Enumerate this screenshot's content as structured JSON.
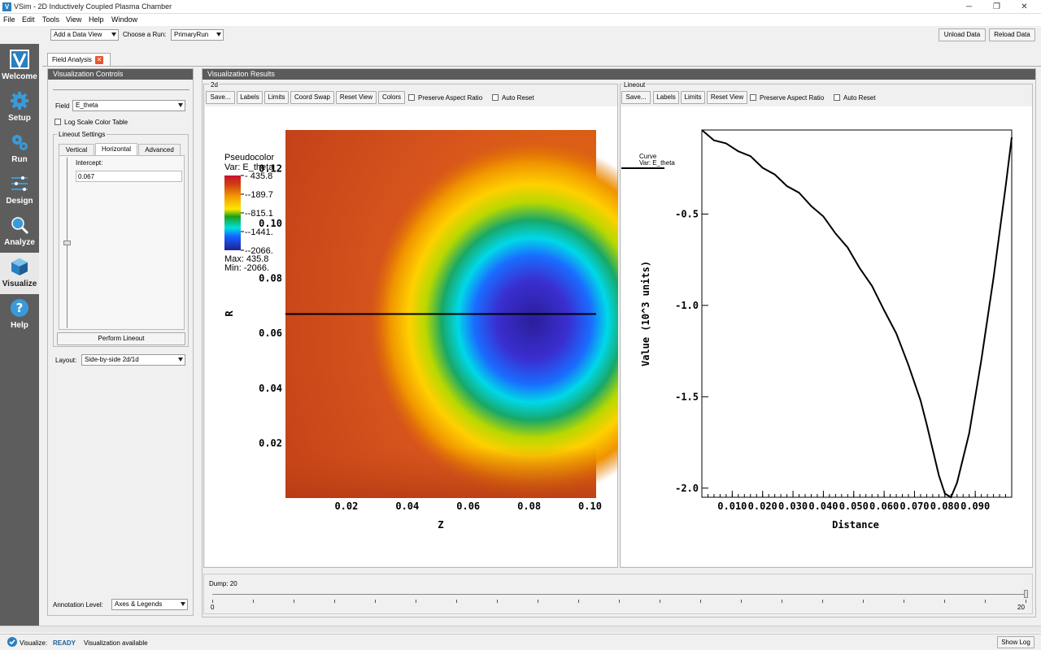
{
  "window": {
    "title": "VSim - 2D Inductively Coupled Plasma Chamber",
    "controls": [
      "─",
      "❐",
      "✕"
    ]
  },
  "menu": [
    "File",
    "Edit",
    "Tools",
    "View",
    "Help",
    "Window"
  ],
  "toolbar": {
    "add_view": "Add a Data View",
    "choose_run_label": "Choose a Run:",
    "run_value": "PrimaryRun",
    "unload": "Unload Data",
    "reload": "Reload Data"
  },
  "sidebar": [
    "Welcome",
    "Setup",
    "Run",
    "Design",
    "Analyze",
    "Visualize",
    "Help"
  ],
  "doc_tab": "Field Analysis",
  "controls": {
    "header": "Visualization Controls",
    "field_label": "Field",
    "field_value": "E_theta",
    "log_scale": "Log Scale Color Table",
    "lineout_settings": "Lineout Settings",
    "tabs": [
      "Vertical",
      "Horizontal",
      "Advanced"
    ],
    "intercept_label": "Intercept:",
    "intercept_value": "0.067",
    "perform": "Perform Lineout",
    "layout_label": "Layout:",
    "layout_value": "Side-by-side 2d/1d",
    "annotation_label": "Annotation Level:",
    "annotation_value": "Axes & Legends"
  },
  "results": {
    "header": "Visualization Results",
    "pane2d": {
      "title": "2d",
      "buttons": [
        "Save...",
        "Labels",
        "Limits",
        "Coord Swap",
        "Reset View",
        "Colors"
      ],
      "preserve": "Preserve Aspect Ratio",
      "auto_reset": "Auto Reset"
    },
    "pane1d": {
      "title": "Lineout",
      "buttons": [
        "Save...",
        "Labels",
        "Limits",
        "Reset View"
      ],
      "preserve": "Preserve Aspect Ratio",
      "auto_reset": "Auto Reset"
    }
  },
  "legend": {
    "title": "Pseudocolor",
    "var": "Var: E_theta",
    "ticks": [
      "435.8",
      "-189.7",
      "-815.1",
      "-1441.",
      "-2066."
    ],
    "max": "Max:  435.8",
    "min": "Min: -2066."
  },
  "colors": {
    "accent": "#2a7fc0",
    "sidebar": "#5d5d5d",
    "panel_header": "#5b5b5b"
  },
  "chart_data": [
    {
      "type": "heatmap",
      "xlabel": "Z",
      "ylabel": "R",
      "x_ticks": [
        "0.02",
        "0.04",
        "0.06",
        "0.08",
        "0.10"
      ],
      "y_ticks": [
        "0.02",
        "0.04",
        "0.06",
        "0.08",
        "0.10",
        "0.12"
      ],
      "xlim": [
        0,
        0.102
      ],
      "ylim": [
        0,
        0.134
      ],
      "lineout_r": 0.067,
      "value_range": [
        -2066,
        435.8
      ],
      "minimum_location": {
        "z": 0.081,
        "r": 0.065
      }
    },
    {
      "type": "line",
      "legend": {
        "title": "Curve",
        "var": "Var: E_theta"
      },
      "xlabel": "Distance",
      "ylabel": "Value (10^3 units)",
      "x_ticks": [
        "0.010",
        "0.020",
        "0.030",
        "0.040",
        "0.050",
        "0.060",
        "0.070",
        "0.080",
        "0.090"
      ],
      "y_ticks": [
        "-0.5",
        "-1.0",
        "-1.5",
        "-2.0"
      ],
      "xlim": [
        0.0,
        0.102
      ],
      "ylim": [
        -2.05,
        -0.04
      ],
      "x": [
        0.0,
        0.004,
        0.008,
        0.012,
        0.016,
        0.02,
        0.024,
        0.028,
        0.032,
        0.036,
        0.04,
        0.044,
        0.048,
        0.052,
        0.056,
        0.06,
        0.064,
        0.068,
        0.072,
        0.074,
        0.076,
        0.078,
        0.08,
        0.082,
        0.084,
        0.088,
        0.092,
        0.096,
        0.1,
        0.102
      ],
      "y": [
        -0.04,
        -0.09,
        -0.12,
        -0.15,
        -0.19,
        -0.24,
        -0.29,
        -0.34,
        -0.39,
        -0.45,
        -0.52,
        -0.6,
        -0.69,
        -0.79,
        -0.9,
        -1.02,
        -1.16,
        -1.32,
        -1.52,
        -1.65,
        -1.79,
        -1.93,
        -2.03,
        -2.05,
        -1.97,
        -1.7,
        -1.3,
        -0.85,
        -0.35,
        -0.08
      ]
    }
  ],
  "timeline": {
    "label": "Dump: 20",
    "min": "0",
    "max": "20",
    "value": 20
  },
  "status": {
    "visualize": "Visualize:",
    "state": "READY",
    "msg": "Visualization available",
    "show_log": "Show Log"
  }
}
